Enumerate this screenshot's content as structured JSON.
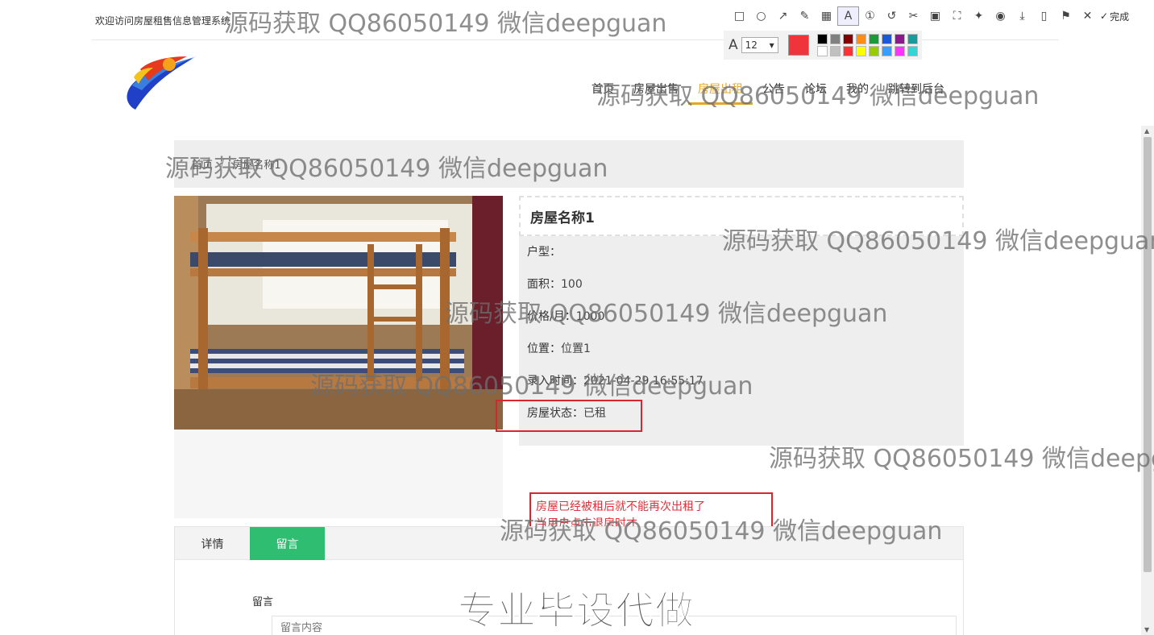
{
  "topbar": {
    "welcome": "欢迎访问房屋租售信息管理系统"
  },
  "nav": {
    "items": [
      "首页",
      "房屋出售",
      "房屋出租",
      "公告",
      "论坛",
      "我的",
      "跳转到后台"
    ],
    "active_index": 2
  },
  "breadcrumb": {
    "home": "首页",
    "sep": "/",
    "current": "房屋名称1"
  },
  "house": {
    "title": "房屋名称1",
    "rows": [
      {
        "label": "户型：",
        "value": ""
      },
      {
        "label": "面积：",
        "value": "100"
      },
      {
        "label": "价格/月：",
        "value": "1000"
      },
      {
        "label": "位置：",
        "value": "位置1"
      },
      {
        "label": "录入时间：",
        "value": "2021-04-29 16:55:17"
      },
      {
        "label": "房屋状态：",
        "value": "已租"
      }
    ]
  },
  "annotation": {
    "line1": "房屋已经被租后就不能再次出租了",
    "line2": "当用户点击退房时才"
  },
  "tabs": {
    "items": [
      "详情",
      "留言"
    ],
    "active_index": 1
  },
  "message": {
    "label": "留言",
    "placeholder": "留言内容"
  },
  "screenshot_tool": {
    "done_label": "完成",
    "font_size": "12",
    "current_color": "#f0343b",
    "palette": [
      "#000000",
      "#808080",
      "#800000",
      "#ff8c1a",
      "#1a9a3a",
      "#1f58d6",
      "#8a1a8a",
      "#1a9a9a",
      "#ffffff",
      "#c0c0c0",
      "#ff3333",
      "#ffff00",
      "#99cc00",
      "#33a0ff",
      "#ff33ff",
      "#33d6d6"
    ],
    "tools": [
      "rect-icon",
      "circle-icon",
      "arrow-icon",
      "pen-icon",
      "mosaic-icon",
      "text-icon",
      "number-icon",
      "undo-icon",
      "cut-icon",
      "ocr-icon",
      "scan-icon",
      "pin-icon",
      "record-icon",
      "download-icon",
      "save-icon",
      "bookmark-icon",
      "close-icon"
    ]
  },
  "watermarks": [
    "源码获取 QQ86050149 微信deepguan",
    "源码获取 QQ86050149 微信deepguan",
    "源码获取 QQ86050149 微信deepguan",
    "源码获取 QQ86050149 微信deepguan",
    "源码获取 QQ86050149 微信deepguan",
    "源码获取 QQ86050149 微信deepguan",
    "源码获取 QQ86050149 微信deepg",
    "源码获取 QQ86050149 微信deepguan"
  ],
  "watermark_big": "专业毕设代做"
}
